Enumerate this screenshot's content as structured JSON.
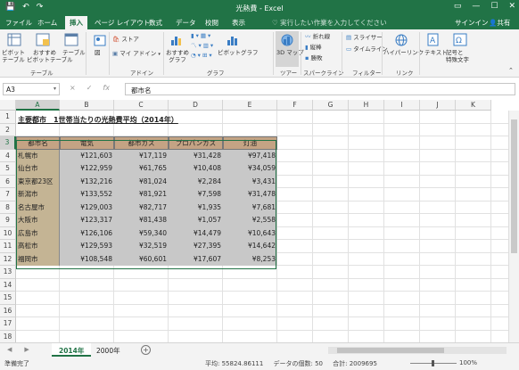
{
  "window": {
    "title": "光熱費 - Excel",
    "qat_icons": [
      "save-icon",
      "undo-icon",
      "redo-icon"
    ]
  },
  "tabs": [
    "ファイル",
    "ホーム",
    "挿入",
    "ページ レイアウト",
    "数式",
    "データ",
    "校閲",
    "表示"
  ],
  "active_tab": "挿入",
  "tell_me": "実行したい作業を入力してください",
  "signin": "サインイン",
  "share": "共有",
  "ribbon": {
    "pivot_table": "ピボット\nテーブル",
    "recommended_pivot": "おすすめ\nピボットテーブル",
    "table": "テーブル",
    "group_table": "テーブル",
    "illustrations": "図",
    "store": "ストア",
    "my_addins": "マイ アドイン",
    "group_addins": "アドイン",
    "recommended_charts": "おすすめ\nグラフ",
    "pivot_chart": "ピボットグラフ",
    "group_charts": "グラフ",
    "map3d": "3D マップ",
    "group_tours": "ツアー",
    "sparkline_line": "折れ線",
    "sparkline_column": "縦棒",
    "sparkline_winloss": "勝敗",
    "group_sparklines": "スパークライン",
    "slicer": "スライサー",
    "timeline": "タイムライン",
    "group_filters": "フィルター",
    "hyperlink": "ハイパーリンク",
    "group_links": "リンク",
    "text": "テキスト",
    "symbols": "記号と\n特殊文字"
  },
  "formula_bar": {
    "name_box": "A3",
    "cancel": "×",
    "enter": "✓",
    "fx": "fx",
    "content": "都市名"
  },
  "columns": [
    "A",
    "B",
    "C",
    "D",
    "E",
    "F",
    "G",
    "H",
    "I",
    "J",
    "K"
  ],
  "rows": [
    "1",
    "2",
    "3",
    "4",
    "5",
    "6",
    "7",
    "8",
    "9",
    "10",
    "11",
    "12",
    "13",
    "14",
    "15",
    "16",
    "17",
    "18"
  ],
  "sheet": {
    "title": "主要都市　1世帯当たりの光熱費平均（2014年）",
    "headers": [
      "都市名",
      "電気",
      "都市ガス",
      "プロパンガス",
      "灯油"
    ],
    "data": [
      [
        "札幌市",
        "¥121,603",
        "¥17,119",
        "¥31,428",
        "¥97,418"
      ],
      [
        "仙台市",
        "¥122,959",
        "¥61,765",
        "¥10,408",
        "¥34,059"
      ],
      [
        "東京都23区",
        "¥132,216",
        "¥81,024",
        "¥2,284",
        "¥3,431"
      ],
      [
        "新潟市",
        "¥133,552",
        "¥81,921",
        "¥7,598",
        "¥31,478"
      ],
      [
        "名古屋市",
        "¥129,003",
        "¥82,717",
        "¥1,935",
        "¥7,681"
      ],
      [
        "大阪市",
        "¥123,317",
        "¥81,438",
        "¥1,057",
        "¥2,558"
      ],
      [
        "広島市",
        "¥126,106",
        "¥59,340",
        "¥14,479",
        "¥10,643"
      ],
      [
        "高松市",
        "¥129,593",
        "¥32,519",
        "¥27,395",
        "¥14,642"
      ],
      [
        "福岡市",
        "¥108,548",
        "¥60,601",
        "¥17,607",
        "¥8,253"
      ]
    ]
  },
  "sheet_tabs": [
    "2014年",
    "2000年"
  ],
  "active_sheet": "2014年",
  "status": {
    "ready": "準備完了",
    "average": "平均: 55824.86111",
    "count": "データの個数: 50",
    "sum": "合計: 2009695",
    "zoom": "100%"
  },
  "colors": {
    "excel_green": "#217346",
    "header_fill": "#c4a384",
    "city_fill": "#c4b494",
    "value_fill": "#c8c8c8"
  }
}
